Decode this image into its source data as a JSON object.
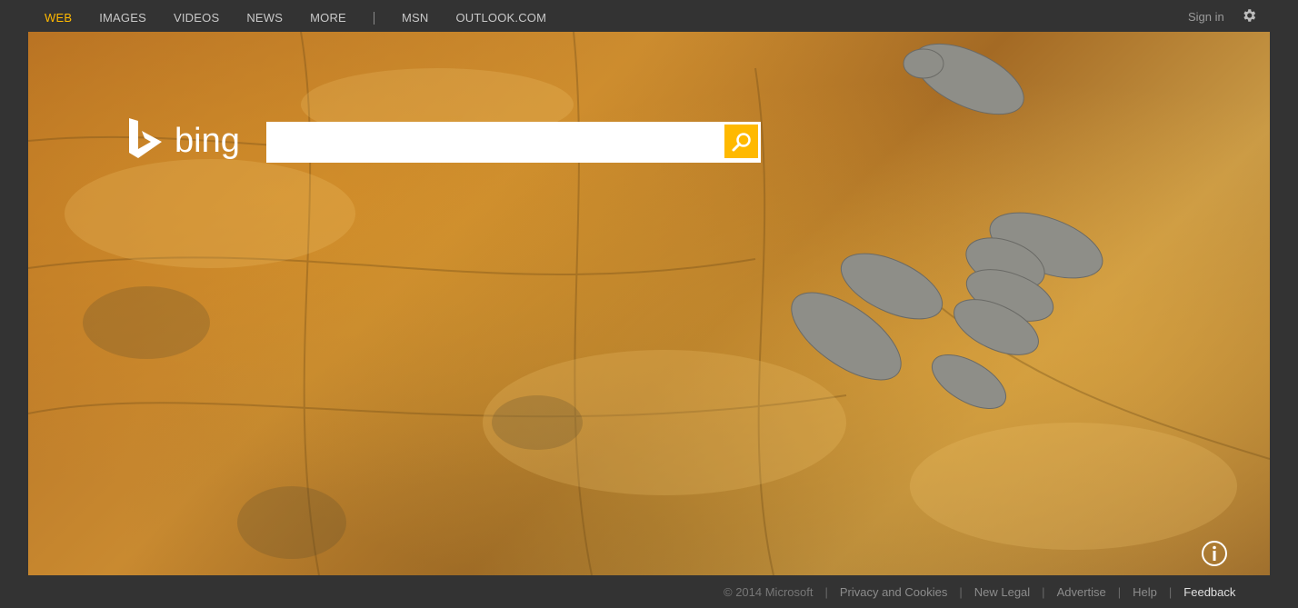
{
  "nav": {
    "items": [
      {
        "label": "WEB",
        "active": true
      },
      {
        "label": "IMAGES",
        "active": false
      },
      {
        "label": "VIDEOS",
        "active": false
      },
      {
        "label": "NEWS",
        "active": false
      },
      {
        "label": "MORE",
        "active": false
      }
    ],
    "secondary": [
      {
        "label": "MSN"
      },
      {
        "label": "OUTLOOK.COM"
      }
    ],
    "signin": "Sign in",
    "settings_icon": "gear-icon",
    "active_color": "#ffb900"
  },
  "hero": {
    "logo_text": "bing",
    "search": {
      "value": "",
      "placeholder": ""
    },
    "search_icon": "search-icon",
    "info_icon": "info-icon"
  },
  "footer": {
    "copyright": "© 2014 Microsoft",
    "links": [
      "Privacy and Cookies",
      "New Legal",
      "Advertise",
      "Help"
    ],
    "feedback": "Feedback"
  }
}
